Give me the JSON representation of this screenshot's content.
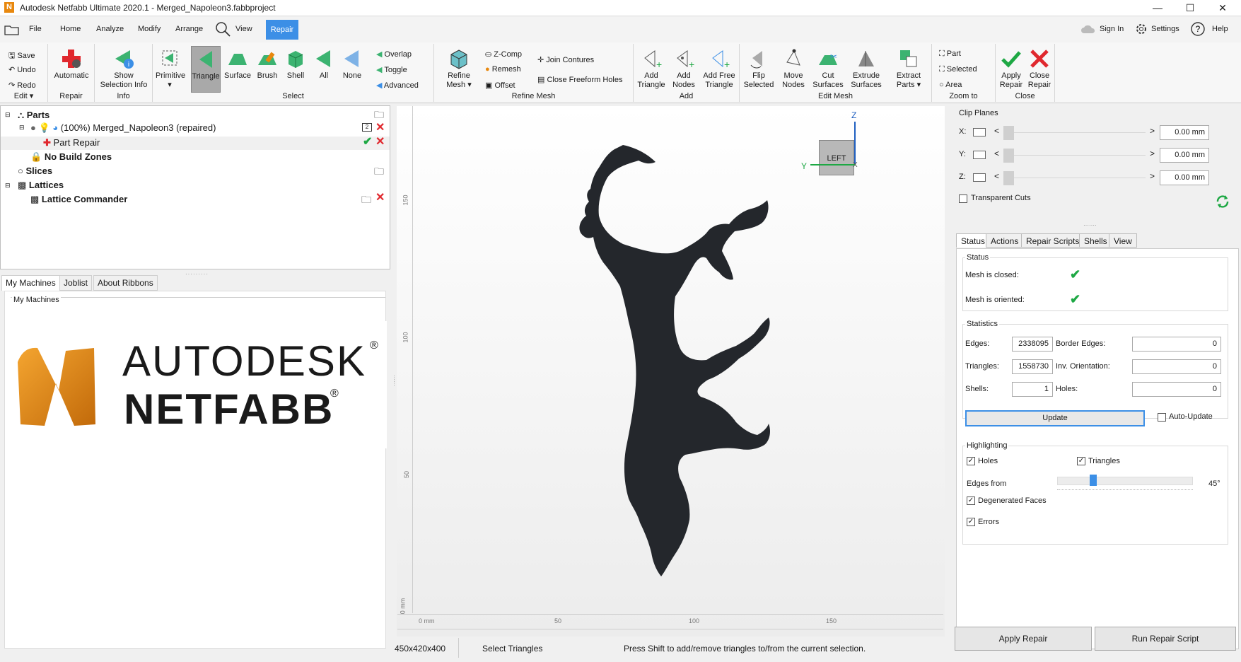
{
  "window": {
    "title": "Autodesk Netfabb Ultimate 2020.1 - Merged_Napoleon3.fabbproject",
    "minimize": "—",
    "maximize": "☐",
    "close": "✕"
  },
  "menu": {
    "file": "File",
    "home": "Home",
    "analyze": "Analyze",
    "modify": "Modify",
    "arrange": "Arrange",
    "view": "View",
    "repair": "Repair",
    "sign_in": "Sign In",
    "settings": "Settings",
    "help": "Help"
  },
  "ribbon": {
    "edit": {
      "save": "Save",
      "undo": "Undo",
      "redo": "Redo",
      "label": "Edit ▾"
    },
    "repair": {
      "automatic": "Automatic",
      "label": "Repair"
    },
    "info": {
      "show_line1": "Show",
      "show_line2": "Selection Info",
      "label": "Info"
    },
    "select": {
      "primitive": "Primitive",
      "triangle": "Triangle",
      "surface": "Surface",
      "brush": "Brush",
      "shell": "Shell",
      "all": "All",
      "none": "None",
      "overlap": "Overlap",
      "toggle": "Toggle",
      "advanced": "Advanced",
      "label": "Select"
    },
    "refine": {
      "refine_line1": "Refine",
      "refine_line2": "Mesh ▾",
      "zcomp": "Z-Comp",
      "remesh": "Remesh",
      "offset": "Offset",
      "join": "Join Contures",
      "close_holes": "Close Freeform Holes",
      "label": "Refine Mesh"
    },
    "add": {
      "add_tri_1": "Add",
      "add_tri_2": "Triangle",
      "add_nodes_1": "Add",
      "add_nodes_2": "Nodes",
      "add_free_1": "Add Free",
      "add_free_2": "Triangle",
      "label": "Add"
    },
    "editmesh": {
      "flip_1": "Flip",
      "flip_2": "Selected",
      "move_1": "Move",
      "move_2": "Nodes",
      "cut_1": "Cut",
      "cut_2": "Surfaces",
      "extrude_1": "Extrude",
      "extrude_2": "Surfaces",
      "extract_1": "Extract",
      "extract_2": "Parts ▾",
      "label": "Edit Mesh"
    },
    "zoom": {
      "part": "Part",
      "selected": "Selected",
      "area": "Area",
      "label": "Zoom to"
    },
    "close": {
      "apply_1": "Apply",
      "apply_2": "Repair",
      "close_1": "Close",
      "close_2": "Repair",
      "label": "Close"
    }
  },
  "tree": {
    "parts": "Parts",
    "part_name": "(100%) Merged_Napoleon3 (repaired)",
    "part_badge": "2",
    "part_repair": "Part Repair",
    "no_build": "No Build Zones",
    "slices": "Slices",
    "lattices": "Lattices",
    "lattice_commander": "Lattice Commander"
  },
  "left_tabs": {
    "my_machines": "My Machines",
    "joblist": "Joblist",
    "about": "About Ribbons"
  },
  "machines": {
    "group_label": "My Machines",
    "brand1": "AUTODESK",
    "brand2": "NETFABB",
    "reg": "®"
  },
  "viewport": {
    "cube_label": "LEFT",
    "axis_z": "Z",
    "axis_y": "Y",
    "axis_x": "X",
    "ruler_v": [
      "150",
      "100",
      "50",
      "0 mm"
    ],
    "ruler_h": [
      "0 mm",
      "50",
      "100",
      "150"
    ]
  },
  "clip": {
    "title": "Clip Planes",
    "x_label": "X:",
    "y_label": "Y:",
    "z_label": "Z:",
    "x_val": "0.00 mm",
    "y_val": "0.00 mm",
    "z_val": "0.00 mm",
    "transparent": "Transparent Cuts"
  },
  "right_tabs": {
    "status": "Status",
    "actions": "Actions",
    "scripts": "Repair Scripts",
    "shells": "Shells",
    "view": "View"
  },
  "status": {
    "title": "Status",
    "closed": "Mesh is closed:",
    "oriented": "Mesh is oriented:"
  },
  "stats": {
    "title": "Statistics",
    "edges_l": "Edges:",
    "edges": "2338095",
    "border_l": "Border Edges:",
    "border": "0",
    "tri_l": "Triangles:",
    "tri": "1558730",
    "inv_l": "Inv. Orientation:",
    "inv": "0",
    "shells_l": "Shells:",
    "shells": "1",
    "holes_l": "Holes:",
    "holes": "0",
    "update": "Update",
    "auto_update": "Auto-Update"
  },
  "highlight": {
    "title": "Highlighting",
    "holes": "Holes",
    "triangles": "Triangles",
    "edges_from": "Edges from",
    "angle": "45°",
    "edges_from_value": 0.25,
    "degenerated": "Degenerated Faces",
    "errors": "Errors"
  },
  "bottom": {
    "apply": "Apply Repair",
    "run": "Run Repair Script"
  },
  "statusbar": {
    "size": "450x420x400",
    "mode": "Select Triangles",
    "hint": "Press Shift to add/remove triangles to/from the current selection."
  },
  "colors": {
    "accent": "#3c8fe6",
    "green": "#1ea844",
    "red": "#e0282e",
    "orange": "#e8880e"
  }
}
